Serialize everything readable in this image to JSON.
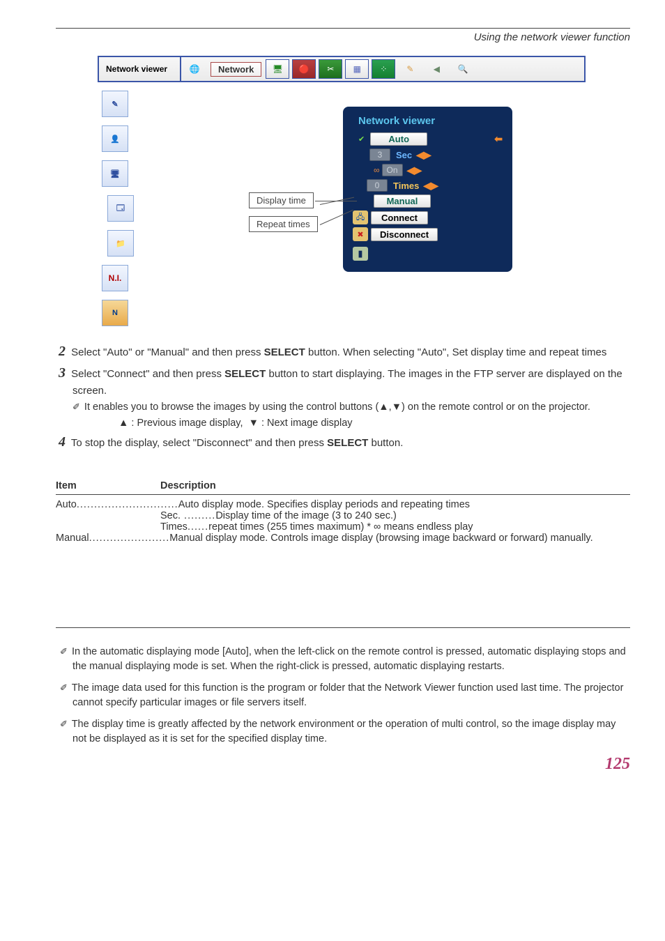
{
  "header": {
    "section": "Using the network viewer function"
  },
  "topbar": {
    "title": "Network viewer",
    "network_label": "Network"
  },
  "side_icons": [
    "pen-icon",
    "person-icon",
    "display-icon",
    "stack-icon",
    "folder-icon",
    "ni-icon",
    "n-icon"
  ],
  "side_ni": "N.I.",
  "side_n": "N",
  "panel": {
    "title": "Network viewer",
    "auto": "Auto",
    "sec_val": "3",
    "sec_lbl": "Sec",
    "on_lbl": "On",
    "times_val": "0",
    "times_lbl": "Times",
    "manual": "Manual",
    "connect": "Connect",
    "disconnect": "Disconnect"
  },
  "callouts": {
    "display_time": "Display time",
    "repeat_times": "Repeat times"
  },
  "steps": {
    "s2": "Select \"Auto\" or \"Manual\" and then press SELECT button. When selecting \"Auto\", Set display time and repeat times",
    "s3": "Select \"Connect\" and then press SELECT button to start displaying. The images in the FTP server are displayed on the  screen.",
    "s3b": "It enables you to browse the images by using the control buttons (▲,▼) on the remote control or on the projector.",
    "s3c": "▲ : Previous image display,  ▼ : Next image display",
    "s4": "To stop the display, select \"Disconnect\" and then press SELECT button.",
    "select": "SELECT"
  },
  "table": {
    "h_item": "Item",
    "h_desc": "Description",
    "auto_label": "Auto",
    "auto_desc": "Auto display mode. Specifies display periods and repeating times",
    "sec_label": "Sec.",
    "sec_desc": "Display time of the image (3 to 240 sec.)",
    "times_label": "Times",
    "times_desc": "repeat times (255 times maximum) * ∞ means endless play",
    "manual_label": "Manual",
    "manual_desc": "Manual display mode. Controls image display (browsing image backward or forward) manually."
  },
  "notes": {
    "n1": "In the automatic displaying mode [Auto], when the left-click on the remote control is pressed, automatic displaying stops and the manual displaying mode is set. When the right-click is pressed, automatic displaying restarts.",
    "n2": "The image data used for this function is the program or folder that the Network Viewer function used last time. The projector cannot specify particular images or file servers itself.",
    "n3": "The display time is greatly affected by the network environment or the operation of multi control, so the image display may not be displayed as it is set for the specified display time."
  },
  "page_number": "125"
}
